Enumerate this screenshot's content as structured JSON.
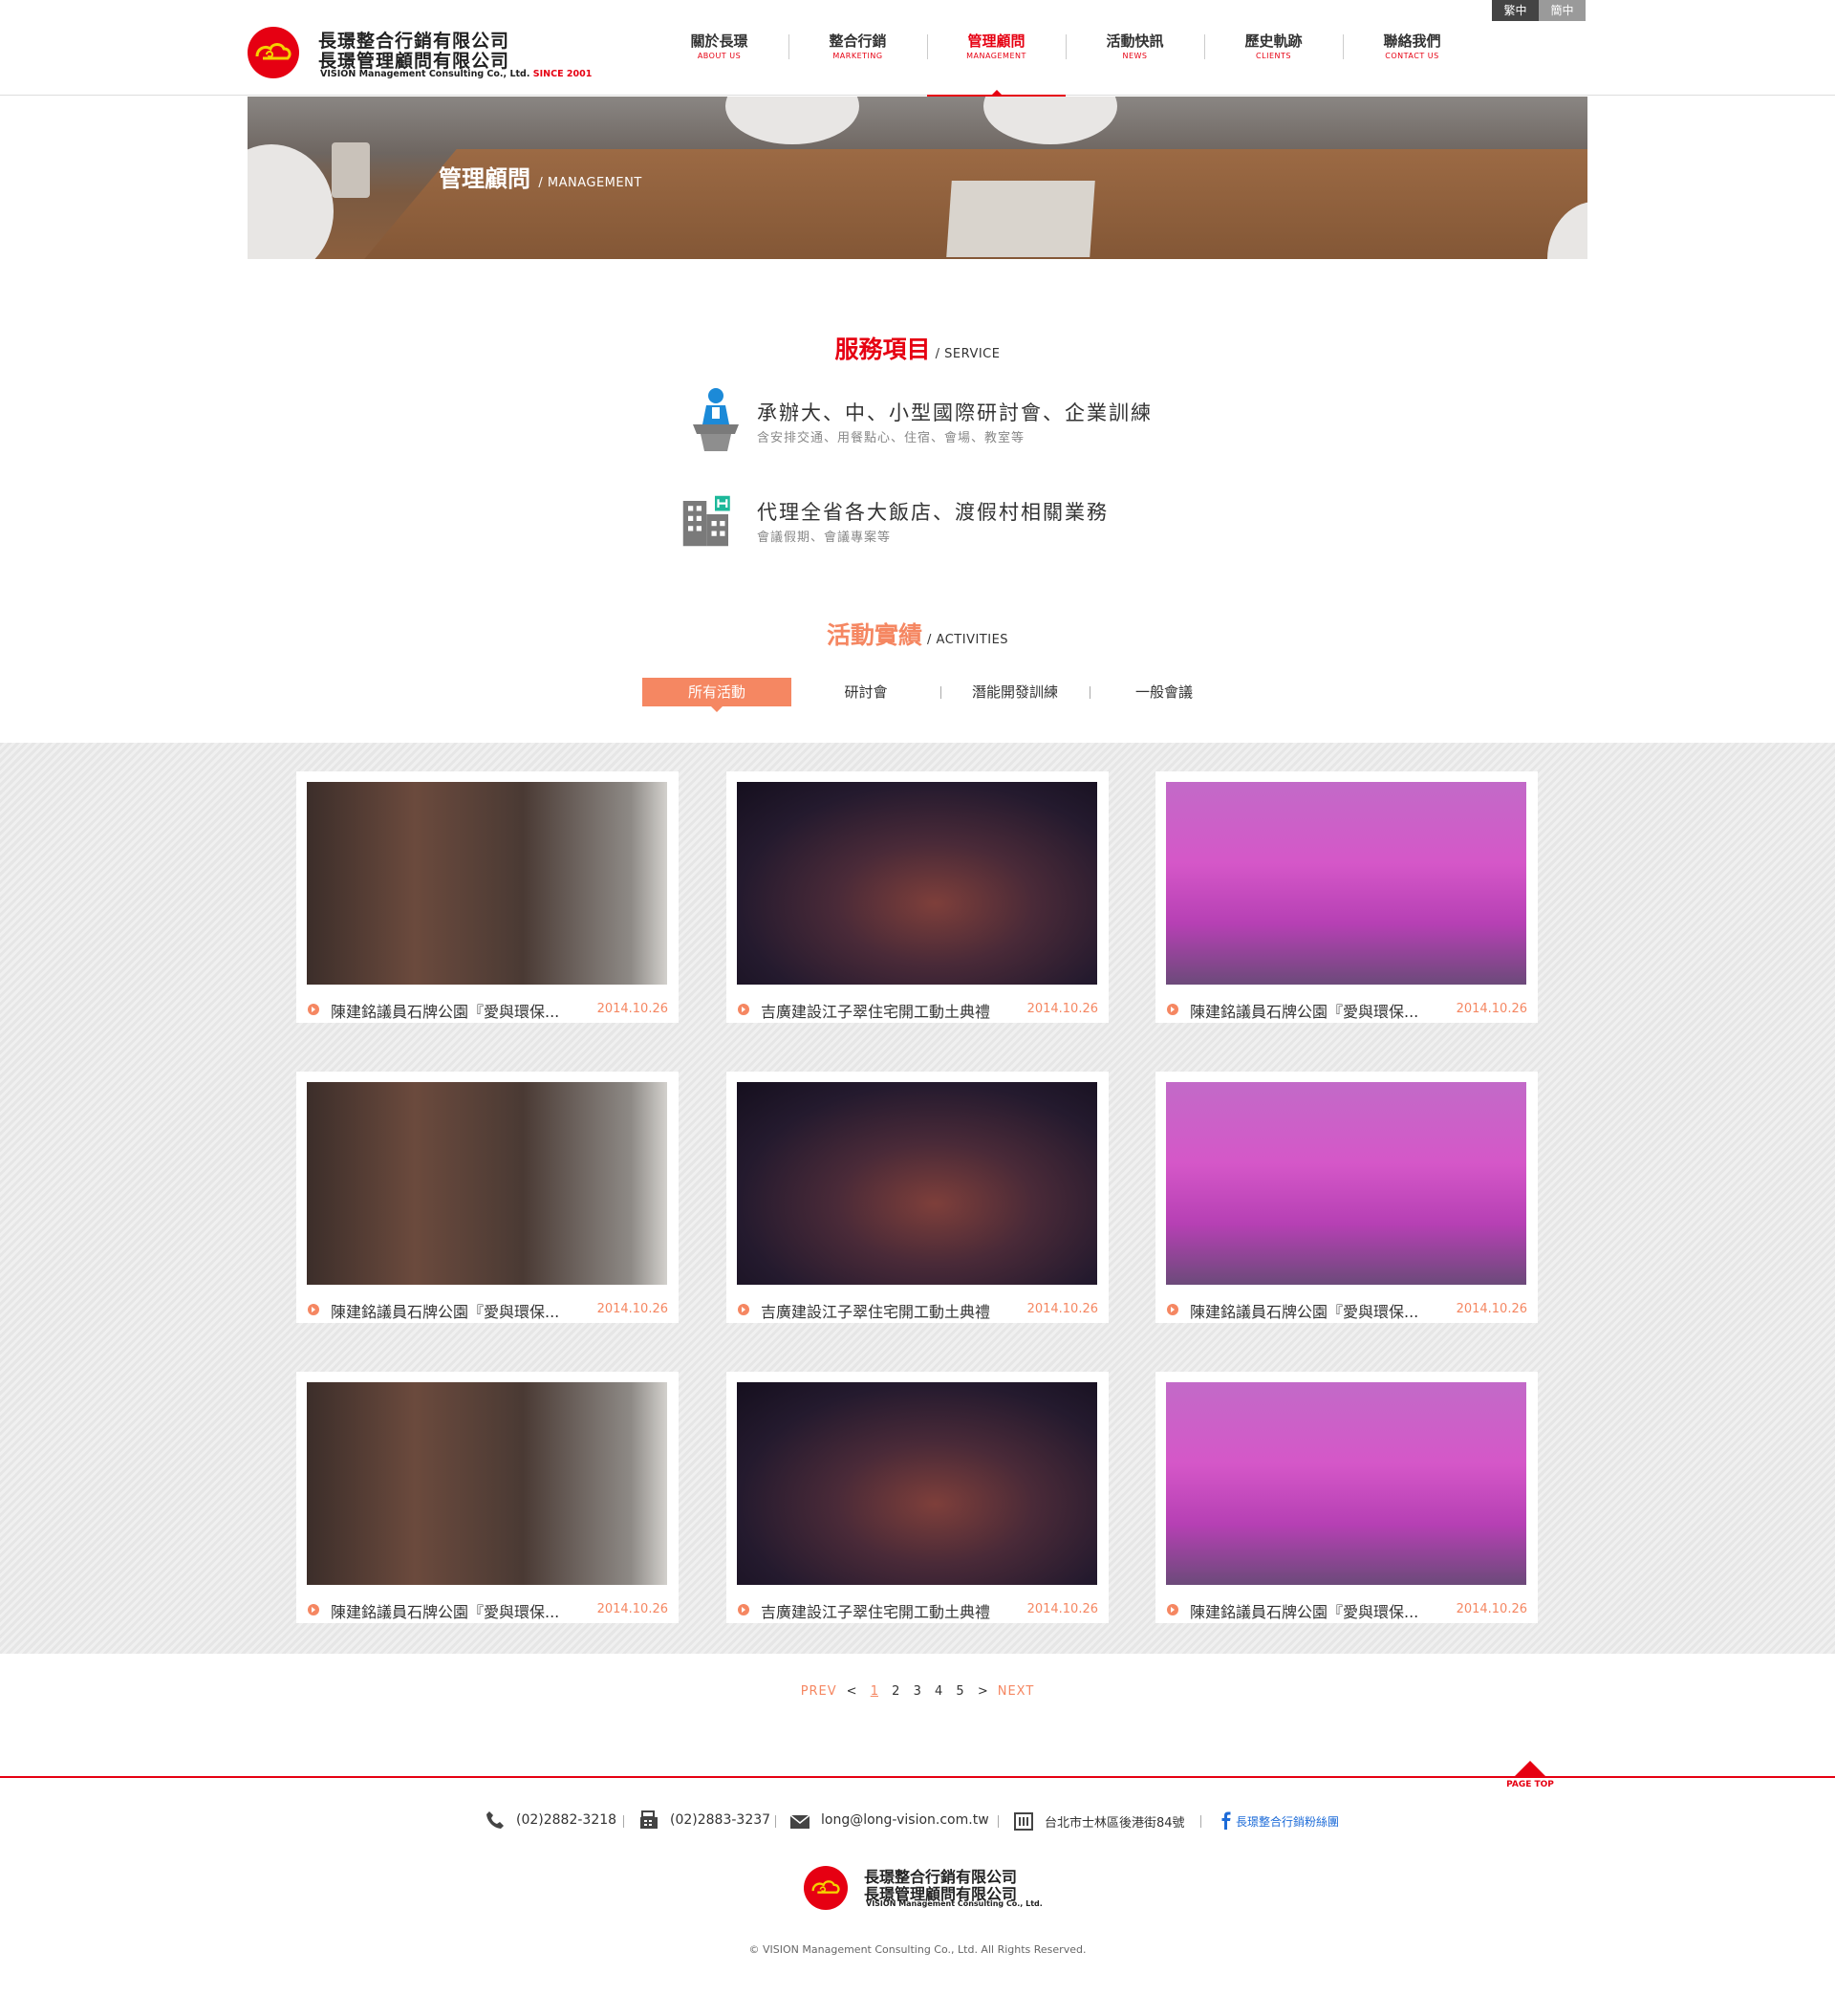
{
  "header": {
    "company_zh_1": "長璟整合行銷有限公司",
    "company_zh_2": "長璟管理顧問有限公司",
    "company_en": "VISION Management Consulting Co., Ltd.",
    "since": "SINCE 2001",
    "brand_color": "#e60012",
    "lang": {
      "trad": "繁中",
      "simp": "簡中"
    },
    "nav": [
      {
        "zh": "關於長璟",
        "en": "ABOUT US"
      },
      {
        "zh": "整合行銷",
        "en": "MARKETING"
      },
      {
        "zh": "管理顧問",
        "en": "MANAGEMENT"
      },
      {
        "zh": "活動快訊",
        "en": "NEWS"
      },
      {
        "zh": "歷史軌跡",
        "en": "CLIENTS"
      },
      {
        "zh": "聯絡我們",
        "en": "CONTACT US"
      }
    ]
  },
  "banner": {
    "title_zh": "管理顧問",
    "title_en": "/ MANAGEMENT"
  },
  "service": {
    "title_zh": "服務項目",
    "title_en": "/ SERVICE",
    "title_color": "#e60012",
    "items": [
      {
        "icon": "lecturer-podium-icon",
        "title": "承辦大、中、小型國際研討會、企業訓練",
        "desc": "含安排交通、用餐點心、住宿、會場、教室等"
      },
      {
        "icon": "hotel-building-icon",
        "title": "代理全省各大飯店、渡假村相關業務",
        "desc": "會議假期、會議專案等"
      }
    ]
  },
  "activities": {
    "title_zh": "活動實績",
    "title_en": "/ ACTIVITIES",
    "accent_color": "#f58762",
    "tabs": [
      "所有活動",
      "研討會",
      "潛能開發訓練",
      "一般會議"
    ],
    "cards": [
      {
        "title": "陳建銘議員石牌公園『愛與環保...",
        "date": "2014.10.26",
        "photo": "poster-wall"
      },
      {
        "title": "吉廣建設江子翠住宅開工動土典禮",
        "date": "2014.10.26",
        "photo": "banquet-table"
      },
      {
        "title": "陳建銘議員石牌公園『愛與環保...",
        "date": "2014.10.26",
        "photo": "stage-performers"
      },
      {
        "title": "陳建銘議員石牌公園『愛與環保...",
        "date": "2014.10.26",
        "photo": "poster-wall"
      },
      {
        "title": "吉廣建設江子翠住宅開工動土典禮",
        "date": "2014.10.26",
        "photo": "banquet-table"
      },
      {
        "title": "陳建銘議員石牌公園『愛與環保...",
        "date": "2014.10.26",
        "photo": "stage-performers"
      },
      {
        "title": "陳建銘議員石牌公園『愛與環保...",
        "date": "2014.10.26",
        "photo": "poster-wall"
      },
      {
        "title": "吉廣建設江子翠住宅開工動土典禮",
        "date": "2014.10.26",
        "photo": "banquet-table"
      },
      {
        "title": "陳建銘議員石牌公園『愛與環保...",
        "date": "2014.10.26",
        "photo": "stage-performers"
      }
    ]
  },
  "pagination": {
    "prev": "PREV",
    "prev_arrow": "<",
    "pages": [
      "1",
      "2",
      "3",
      "4",
      "5"
    ],
    "current": "1",
    "next_arrow": ">",
    "next": "NEXT"
  },
  "footer": {
    "page_top": "PAGE TOP",
    "phone": "(02)2882-3218",
    "fax": "(02)2883-3237",
    "email": "long@long-vision.com.tw",
    "address": "台北市士林區後港街84號",
    "facebook": "長璟整合行銷粉絲團",
    "company_zh_1": "長璟整合行銷有限公司",
    "company_zh_2": "長璟管理顧問有限公司",
    "company_en": "VISION Management Consulting Co., Ltd.",
    "copyright": "© VISION Management Consulting Co., Ltd. All Rights Reserved."
  }
}
